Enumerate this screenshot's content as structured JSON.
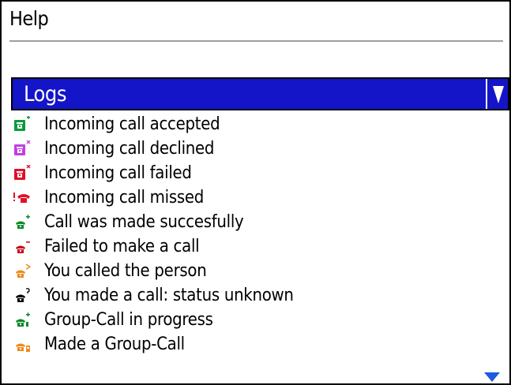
{
  "screen": {
    "title": "Help"
  },
  "dropdown": {
    "label": "Logs"
  },
  "log_items": [
    {
      "label": "Incoming call accepted",
      "icon": "call-accepted-icon",
      "color": "#0a9a3a"
    },
    {
      "label": "Incoming call declined",
      "icon": "call-declined-icon",
      "color": "#c040e0"
    },
    {
      "label": "Incoming call failed",
      "icon": "call-failed-icon",
      "color": "#e0102a"
    },
    {
      "label": "Incoming call missed",
      "icon": "call-missed-icon",
      "color": "#e0102a"
    },
    {
      "label": "Call was made succesfully",
      "icon": "outgoing-success-icon",
      "color": "#0a8a2a"
    },
    {
      "label": "Failed to make a call",
      "icon": "outgoing-failed-icon",
      "color": "#c81020"
    },
    {
      "label": "You called the person",
      "icon": "outgoing-called-icon",
      "color": "#f08a1a"
    },
    {
      "label": "You made a call: status unknown",
      "icon": "outgoing-unknown-icon",
      "color": "#000000"
    },
    {
      "label": "Group-Call in progress",
      "icon": "group-call-progress-icon",
      "color": "#0a8a2a"
    },
    {
      "label": "Made a Group-Call",
      "icon": "group-call-made-icon",
      "color": "#f08a1a"
    }
  ],
  "colors": {
    "accent": "#1414c8",
    "scroll_indicator": "#1e5adc"
  }
}
